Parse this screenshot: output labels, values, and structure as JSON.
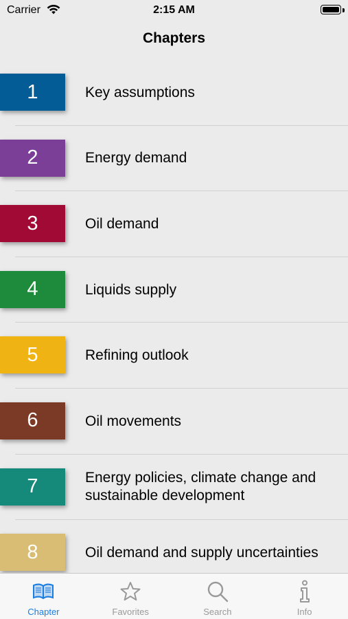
{
  "status_bar": {
    "carrier": "Carrier",
    "time": "2:15 AM"
  },
  "nav": {
    "title": "Chapters"
  },
  "chapters": [
    {
      "number": "1",
      "title": "Key assumptions",
      "color": "#045c96"
    },
    {
      "number": "2",
      "title": "Energy demand",
      "color": "#7b3f98"
    },
    {
      "number": "3",
      "title": "Oil demand",
      "color": "#a00a34"
    },
    {
      "number": "4",
      "title": "Liquids supply",
      "color": "#1e8a3c"
    },
    {
      "number": "5",
      "title": "Refining outlook",
      "color": "#efb413"
    },
    {
      "number": "6",
      "title": "Oil movements",
      "color": "#7a3a26"
    },
    {
      "number": "7",
      "title": "Energy policies, climate change and sustainable development",
      "color": "#168a7a"
    },
    {
      "number": "8",
      "title": "Oil demand and supply uncertainties",
      "color": "#d9bd75"
    }
  ],
  "tabs": [
    {
      "label": "Chapter",
      "icon": "book-icon",
      "active": true
    },
    {
      "label": "Favorites",
      "icon": "star-icon",
      "active": false
    },
    {
      "label": "Search",
      "icon": "search-icon",
      "active": false
    },
    {
      "label": "Info",
      "icon": "info-icon",
      "active": false
    }
  ],
  "colors": {
    "accent": "#1a7de0",
    "inactive": "#999999",
    "background": "#ebebeb"
  }
}
